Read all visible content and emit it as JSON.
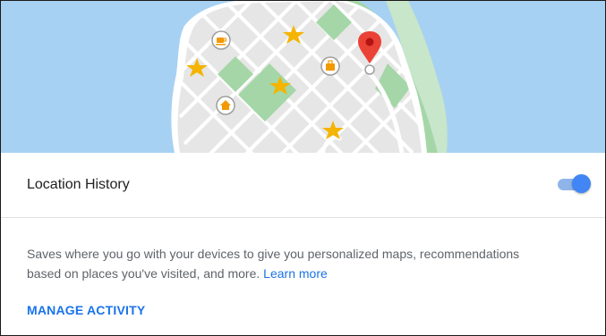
{
  "banner": {
    "icons": [
      "cafe-pin-icon",
      "shopping-pin-icon",
      "home-pin-icon",
      "star-icon",
      "location-pin-icon"
    ],
    "colors": {
      "water": "#a7d1f2",
      "land": "#e8e8e8",
      "park": "#a5d6a7",
      "road": "#ffffff",
      "star": "#f4b400",
      "pin": "#ea4335"
    }
  },
  "setting": {
    "label": "Location History",
    "toggle_on": true
  },
  "description": {
    "line1": "Saves where you go with your devices to give you personalized maps, recommendations",
    "line2_text": "based on places you've visited, and more.",
    "learn_more": "Learn more"
  },
  "actions": {
    "manage_activity": "MANAGE ACTIVITY"
  },
  "colors": {
    "accent": "#1a73e8",
    "toggle_thumb": "#4285f4",
    "toggle_track": "#8fb4ea"
  }
}
